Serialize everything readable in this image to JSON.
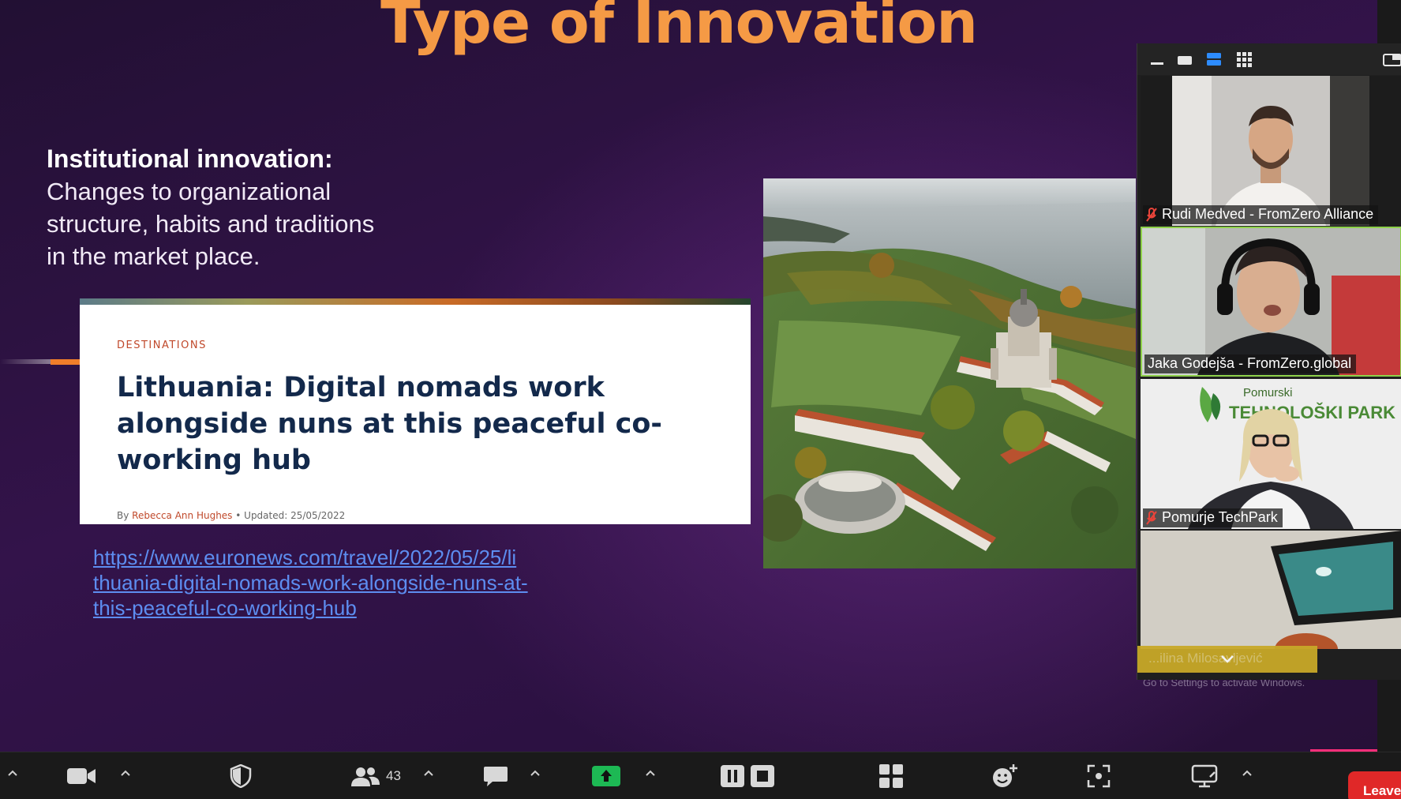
{
  "slide": {
    "title": "Type of Innovation",
    "heading": "Institutional innovation:",
    "body_lines": [
      "Changes to organizational",
      "structure, habits and traditions",
      "in the market place."
    ],
    "article": {
      "section": "DESTINATIONS",
      "title_lines": [
        "Lithuania: Digital nomads work",
        "alongside nuns at this peaceful co-",
        "working hub"
      ],
      "byline_prefix": "By",
      "author": "Rebecca Ann Hughes",
      "updated": "•  Updated: 25/05/2022"
    },
    "link_lines": [
      "https://www.euronews.com/travel/2022/05/25/li",
      "thuania-digital-nomads-work-alongside-nuns-at-",
      "this-peaceful-co-working-hub"
    ]
  },
  "participants": [
    {
      "name": "Rudi Medved - FromZero Alliance",
      "muted": true
    },
    {
      "name": "Jaka Godejša - FromZero.global",
      "muted": false,
      "speaking": true
    },
    {
      "name": "Pomurje TechPark",
      "muted": true,
      "background_text_1": "Pomurski",
      "background_text_2": "TEHNOLOŠKI PARK"
    },
    {
      "name": "...ilina Milosavljević",
      "muted": false
    }
  ],
  "watermark": "Go to Settings to activate Windows.",
  "toolbar": {
    "participants_count": "43",
    "leave_label": "Leave"
  },
  "colors": {
    "title_orange": "#f59a45",
    "link_blue": "#5d8df0",
    "speaking_border": "#8ed14a",
    "share_green": "#1db954",
    "leave_red": "#e02828"
  }
}
